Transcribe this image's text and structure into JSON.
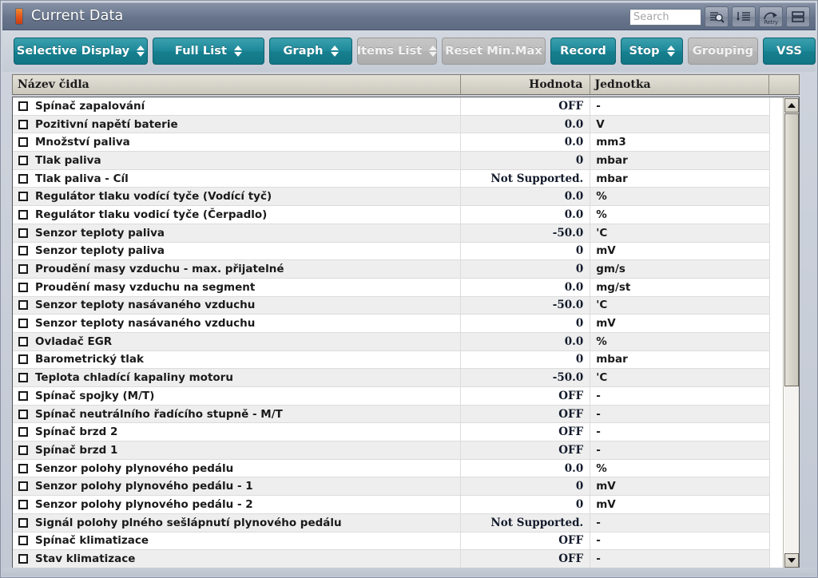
{
  "window": {
    "title": "Current Data",
    "title_marker_color": "#e4541a",
    "titlebar_color": "#67748b"
  },
  "titlebar_controls": {
    "search": {
      "value": "",
      "placeholder": "Search"
    },
    "buttons": [
      {
        "name": "search-submit-icon",
        "label": ""
      },
      {
        "name": "sort-list-icon",
        "label": ""
      },
      {
        "name": "retry-icon",
        "label": "Retry"
      },
      {
        "name": "split-view-icon",
        "label": ""
      }
    ]
  },
  "toolbar": {
    "accent_color": "#16808f",
    "disabled_color": "#b5b5b5",
    "buttons": [
      {
        "label": "Selective Display",
        "style": "teal",
        "spinner": true,
        "enabled": true,
        "width_class": "w-selective"
      },
      {
        "label": "Full List",
        "style": "teal",
        "spinner": true,
        "enabled": true,
        "width_class": "w-fulllist"
      },
      {
        "label": "Graph",
        "style": "teal",
        "spinner": true,
        "enabled": true,
        "width_class": "w-graph"
      },
      {
        "label": "Items List",
        "style": "gray",
        "spinner": true,
        "enabled": false,
        "width_class": "w-items"
      },
      {
        "label": "Reset Min.Max",
        "style": "gray",
        "spinner": false,
        "enabled": false,
        "width_class": "w-reset"
      },
      {
        "label": "Record",
        "style": "teal",
        "spinner": false,
        "enabled": true,
        "width_class": "w-record"
      },
      {
        "label": "Stop",
        "style": "teal",
        "spinner": true,
        "enabled": true,
        "width_class": "w-stop"
      },
      {
        "label": "Grouping",
        "style": "gray",
        "spinner": false,
        "enabled": false,
        "width_class": "w-grouping"
      },
      {
        "label": "VSS",
        "style": "teal",
        "spinner": false,
        "enabled": true,
        "width_class": "w-vss"
      }
    ]
  },
  "table": {
    "columns": [
      "Název čidla",
      "Hodnota",
      "Jednotka",
      ""
    ],
    "rows": [
      {
        "name": "Spínač zapalování",
        "value": "OFF",
        "unit": "-"
      },
      {
        "name": "Pozitivní napětí baterie",
        "value": "0.0",
        "unit": "V"
      },
      {
        "name": "Množství paliva",
        "value": "0.0",
        "unit": "mm3"
      },
      {
        "name": "Tlak paliva",
        "value": "0",
        "unit": "mbar"
      },
      {
        "name": "Tlak paliva - Cíl",
        "value": "Not Supported.",
        "unit": "mbar"
      },
      {
        "name": "Regulátor tlaku vodící tyče (Vodící tyč)",
        "value": "0.0",
        "unit": "%"
      },
      {
        "name": "Regulátor tlaku vodicí tyče (Čerpadlo)",
        "value": "0.0",
        "unit": "%"
      },
      {
        "name": "Senzor teploty paliva",
        "value": "-50.0",
        "unit": "'C"
      },
      {
        "name": "Senzor teploty paliva",
        "value": "0",
        "unit": "mV"
      },
      {
        "name": "Proudění masy vzduchu - max. přijatelné",
        "value": "0",
        "unit": "gm/s"
      },
      {
        "name": "Proudění masy vzduchu na segment",
        "value": "0.0",
        "unit": "mg/st"
      },
      {
        "name": "Senzor teploty nasávaného vzduchu",
        "value": "-50.0",
        "unit": "'C"
      },
      {
        "name": "Senzor teploty nasávaného vzduchu",
        "value": "0",
        "unit": "mV"
      },
      {
        "name": "Ovladač EGR",
        "value": "0.0",
        "unit": "%"
      },
      {
        "name": "Barometrický tlak",
        "value": "0",
        "unit": "mbar"
      },
      {
        "name": "Teplota chladící kapaliny motoru",
        "value": "-50.0",
        "unit": "'C"
      },
      {
        "name": "Spínač spojky (M/T)",
        "value": "OFF",
        "unit": "-"
      },
      {
        "name": "Spínač neutrálního řadícího stupně - M/T",
        "value": "OFF",
        "unit": "-"
      },
      {
        "name": "Spínač brzd 2",
        "value": "OFF",
        "unit": "-"
      },
      {
        "name": "Spínač brzd 1",
        "value": "OFF",
        "unit": "-"
      },
      {
        "name": "Senzor polohy plynového pedálu",
        "value": "0.0",
        "unit": "%"
      },
      {
        "name": "Senzor polohy plynového pedálu - 1",
        "value": "0",
        "unit": "mV"
      },
      {
        "name": "Senzor polohy plynového pedálu - 2",
        "value": "0",
        "unit": "mV"
      },
      {
        "name": "Signál polohy plného sešlápnutí plynového pedálu",
        "value": "Not Supported.",
        "unit": "-"
      },
      {
        "name": "Spínač klimatizace",
        "value": "OFF",
        "unit": "-"
      },
      {
        "name": "Stav klimatizace",
        "value": "OFF",
        "unit": "-"
      }
    ]
  },
  "scrollbar": {
    "up_arrow": "▲",
    "down_arrow": "▼",
    "thumb_fraction": 0.62
  }
}
